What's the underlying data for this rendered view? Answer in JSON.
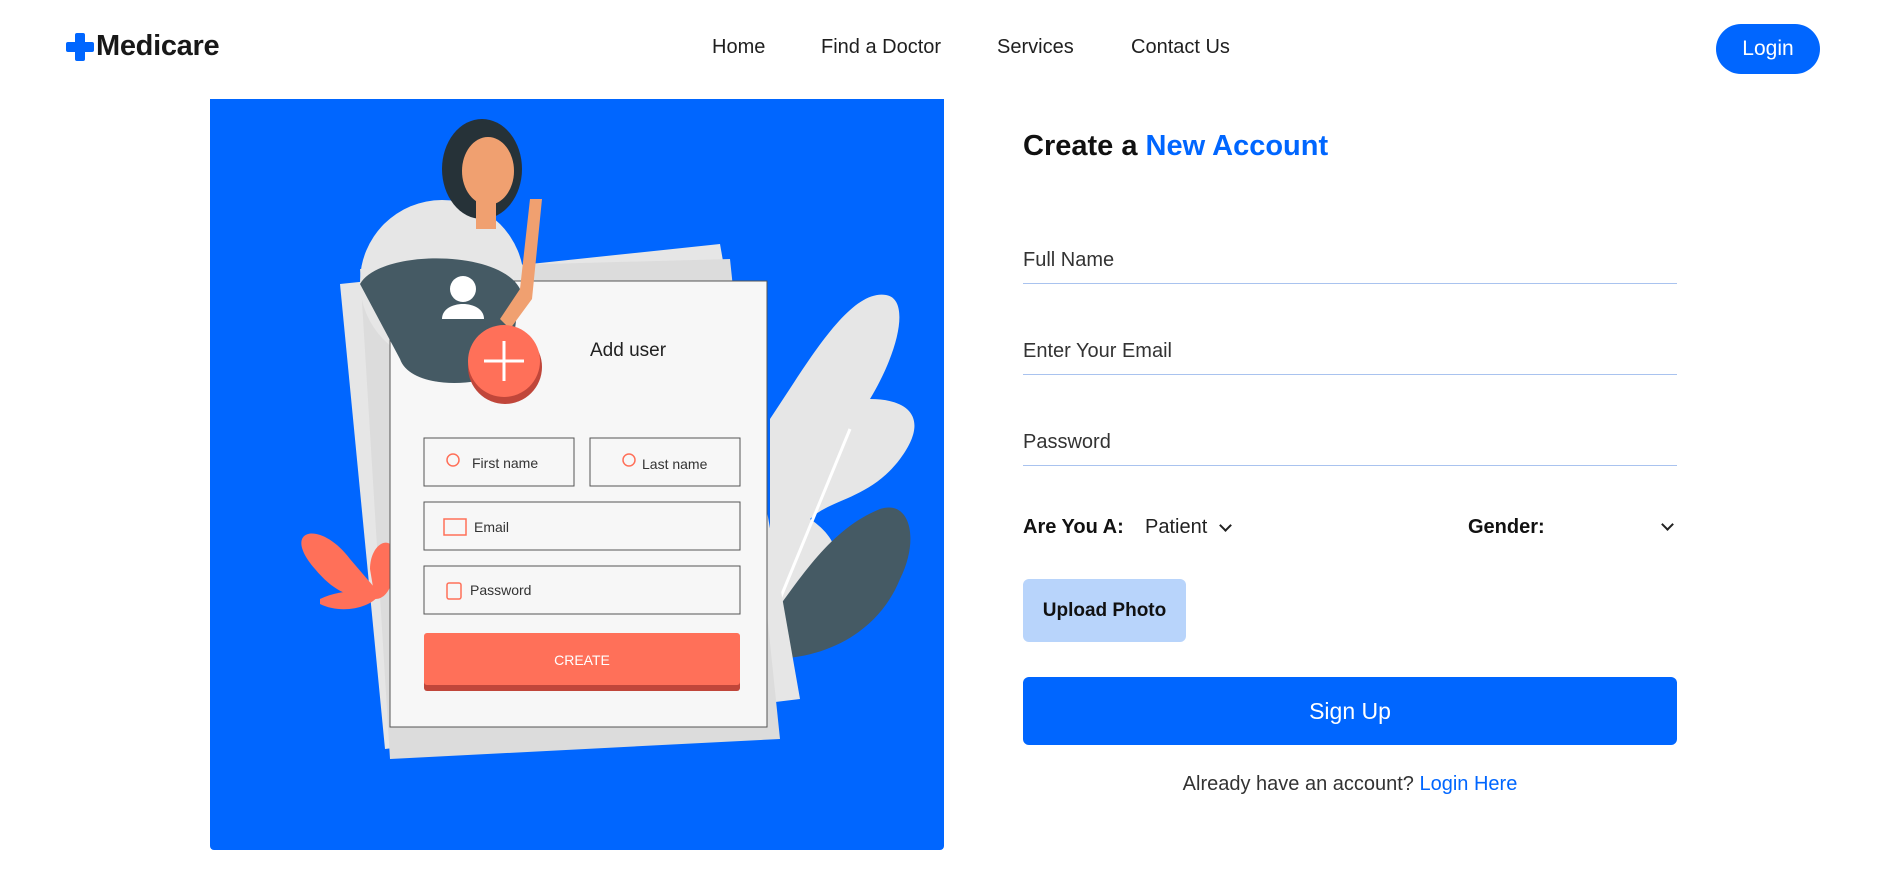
{
  "header": {
    "brand": "Medicare",
    "nav": [
      "Home",
      "Find a Doctor",
      "Services",
      "Contact Us"
    ],
    "login_label": "Login"
  },
  "illustration": {
    "card_title": "Add user",
    "first_name": "First name",
    "last_name": "Last name",
    "email": "Email",
    "password": "Password",
    "create_label": "CREATE"
  },
  "form": {
    "title_prefix": "Create a ",
    "title_accent": "New Account",
    "full_name_placeholder": "Full Name",
    "email_placeholder": "Enter Your Email",
    "password_placeholder": "Password",
    "role_label": "Are You A:",
    "role_value": "Patient",
    "gender_label": "Gender:",
    "gender_value": "",
    "upload_label": "Upload Photo",
    "signup_label": "Sign Up",
    "already_text": "Already have an account? ",
    "login_link": "Login Here"
  },
  "colors": {
    "accent": "#0066ff",
    "upload_bg": "#b8d4fb",
    "illustration_coral": "#ff7059"
  }
}
